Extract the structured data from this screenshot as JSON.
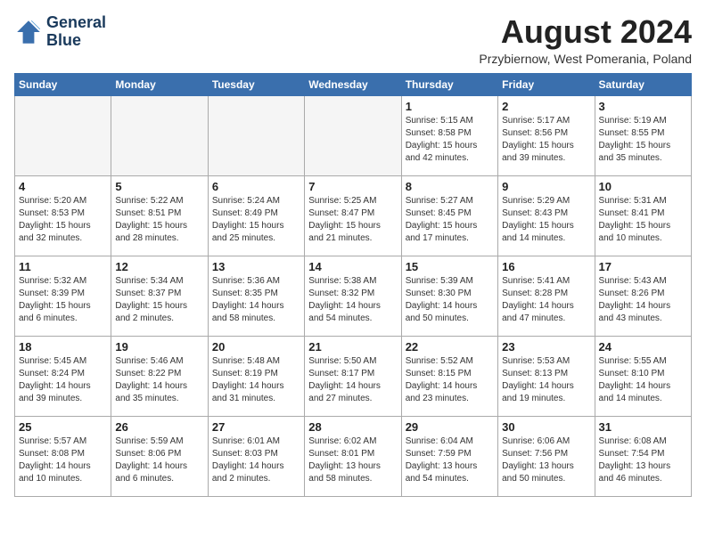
{
  "header": {
    "logo_line1": "General",
    "logo_line2": "Blue",
    "month_title": "August 2024",
    "location": "Przybiernow, West Pomerania, Poland"
  },
  "weekdays": [
    "Sunday",
    "Monday",
    "Tuesday",
    "Wednesday",
    "Thursday",
    "Friday",
    "Saturday"
  ],
  "weeks": [
    [
      {
        "day": "",
        "info": ""
      },
      {
        "day": "",
        "info": ""
      },
      {
        "day": "",
        "info": ""
      },
      {
        "day": "",
        "info": ""
      },
      {
        "day": "1",
        "info": "Sunrise: 5:15 AM\nSunset: 8:58 PM\nDaylight: 15 hours\nand 42 minutes."
      },
      {
        "day": "2",
        "info": "Sunrise: 5:17 AM\nSunset: 8:56 PM\nDaylight: 15 hours\nand 39 minutes."
      },
      {
        "day": "3",
        "info": "Sunrise: 5:19 AM\nSunset: 8:55 PM\nDaylight: 15 hours\nand 35 minutes."
      }
    ],
    [
      {
        "day": "4",
        "info": "Sunrise: 5:20 AM\nSunset: 8:53 PM\nDaylight: 15 hours\nand 32 minutes."
      },
      {
        "day": "5",
        "info": "Sunrise: 5:22 AM\nSunset: 8:51 PM\nDaylight: 15 hours\nand 28 minutes."
      },
      {
        "day": "6",
        "info": "Sunrise: 5:24 AM\nSunset: 8:49 PM\nDaylight: 15 hours\nand 25 minutes."
      },
      {
        "day": "7",
        "info": "Sunrise: 5:25 AM\nSunset: 8:47 PM\nDaylight: 15 hours\nand 21 minutes."
      },
      {
        "day": "8",
        "info": "Sunrise: 5:27 AM\nSunset: 8:45 PM\nDaylight: 15 hours\nand 17 minutes."
      },
      {
        "day": "9",
        "info": "Sunrise: 5:29 AM\nSunset: 8:43 PM\nDaylight: 15 hours\nand 14 minutes."
      },
      {
        "day": "10",
        "info": "Sunrise: 5:31 AM\nSunset: 8:41 PM\nDaylight: 15 hours\nand 10 minutes."
      }
    ],
    [
      {
        "day": "11",
        "info": "Sunrise: 5:32 AM\nSunset: 8:39 PM\nDaylight: 15 hours\nand 6 minutes."
      },
      {
        "day": "12",
        "info": "Sunrise: 5:34 AM\nSunset: 8:37 PM\nDaylight: 15 hours\nand 2 minutes."
      },
      {
        "day": "13",
        "info": "Sunrise: 5:36 AM\nSunset: 8:35 PM\nDaylight: 14 hours\nand 58 minutes."
      },
      {
        "day": "14",
        "info": "Sunrise: 5:38 AM\nSunset: 8:32 PM\nDaylight: 14 hours\nand 54 minutes."
      },
      {
        "day": "15",
        "info": "Sunrise: 5:39 AM\nSunset: 8:30 PM\nDaylight: 14 hours\nand 50 minutes."
      },
      {
        "day": "16",
        "info": "Sunrise: 5:41 AM\nSunset: 8:28 PM\nDaylight: 14 hours\nand 47 minutes."
      },
      {
        "day": "17",
        "info": "Sunrise: 5:43 AM\nSunset: 8:26 PM\nDaylight: 14 hours\nand 43 minutes."
      }
    ],
    [
      {
        "day": "18",
        "info": "Sunrise: 5:45 AM\nSunset: 8:24 PM\nDaylight: 14 hours\nand 39 minutes."
      },
      {
        "day": "19",
        "info": "Sunrise: 5:46 AM\nSunset: 8:22 PM\nDaylight: 14 hours\nand 35 minutes."
      },
      {
        "day": "20",
        "info": "Sunrise: 5:48 AM\nSunset: 8:19 PM\nDaylight: 14 hours\nand 31 minutes."
      },
      {
        "day": "21",
        "info": "Sunrise: 5:50 AM\nSunset: 8:17 PM\nDaylight: 14 hours\nand 27 minutes."
      },
      {
        "day": "22",
        "info": "Sunrise: 5:52 AM\nSunset: 8:15 PM\nDaylight: 14 hours\nand 23 minutes."
      },
      {
        "day": "23",
        "info": "Sunrise: 5:53 AM\nSunset: 8:13 PM\nDaylight: 14 hours\nand 19 minutes."
      },
      {
        "day": "24",
        "info": "Sunrise: 5:55 AM\nSunset: 8:10 PM\nDaylight: 14 hours\nand 14 minutes."
      }
    ],
    [
      {
        "day": "25",
        "info": "Sunrise: 5:57 AM\nSunset: 8:08 PM\nDaylight: 14 hours\nand 10 minutes."
      },
      {
        "day": "26",
        "info": "Sunrise: 5:59 AM\nSunset: 8:06 PM\nDaylight: 14 hours\nand 6 minutes."
      },
      {
        "day": "27",
        "info": "Sunrise: 6:01 AM\nSunset: 8:03 PM\nDaylight: 14 hours\nand 2 minutes."
      },
      {
        "day": "28",
        "info": "Sunrise: 6:02 AM\nSunset: 8:01 PM\nDaylight: 13 hours\nand 58 minutes."
      },
      {
        "day": "29",
        "info": "Sunrise: 6:04 AM\nSunset: 7:59 PM\nDaylight: 13 hours\nand 54 minutes."
      },
      {
        "day": "30",
        "info": "Sunrise: 6:06 AM\nSunset: 7:56 PM\nDaylight: 13 hours\nand 50 minutes."
      },
      {
        "day": "31",
        "info": "Sunrise: 6:08 AM\nSunset: 7:54 PM\nDaylight: 13 hours\nand 46 minutes."
      }
    ]
  ]
}
